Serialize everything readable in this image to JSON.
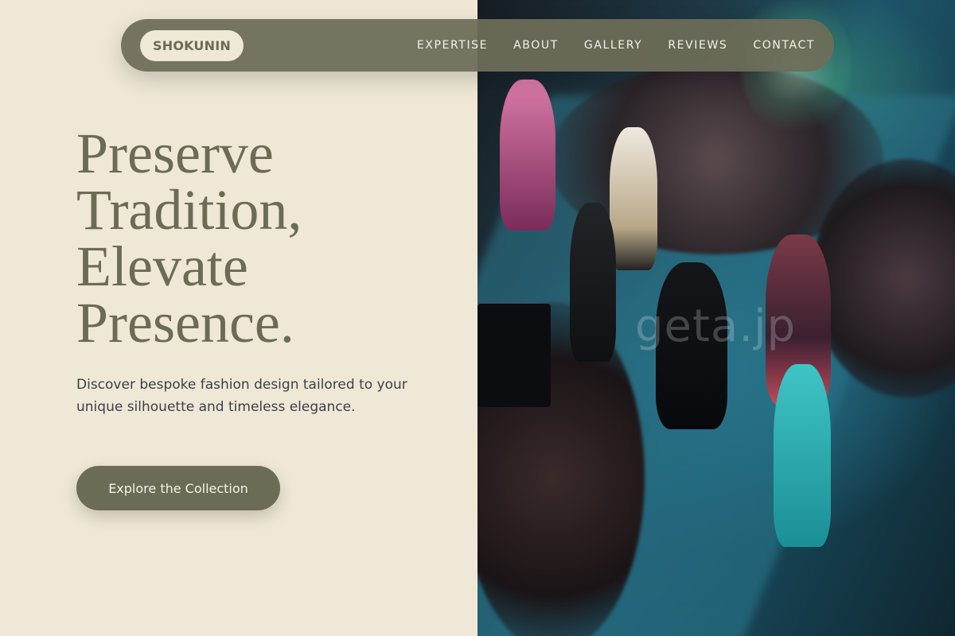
{
  "brand": {
    "logo_text": "SHOKUNIN"
  },
  "nav": {
    "items": [
      {
        "label": "EXPERTISE"
      },
      {
        "label": "ABOUT"
      },
      {
        "label": "GALLERY"
      },
      {
        "label": "REVIEWS"
      },
      {
        "label": "CONTACT"
      }
    ]
  },
  "hero": {
    "title_lines": [
      "Preserve",
      "Tradition,",
      "Elevate",
      "Presence."
    ],
    "description": "Discover bespoke fashion design tailored to your unique silhouette and timeless elegance.",
    "cta_label": "Explore the Collection"
  },
  "image": {
    "watermark_text": "geta.jp"
  },
  "colors": {
    "background": "#efe8d6",
    "accent": "#6b6b56",
    "body_text": "#3b4048"
  }
}
